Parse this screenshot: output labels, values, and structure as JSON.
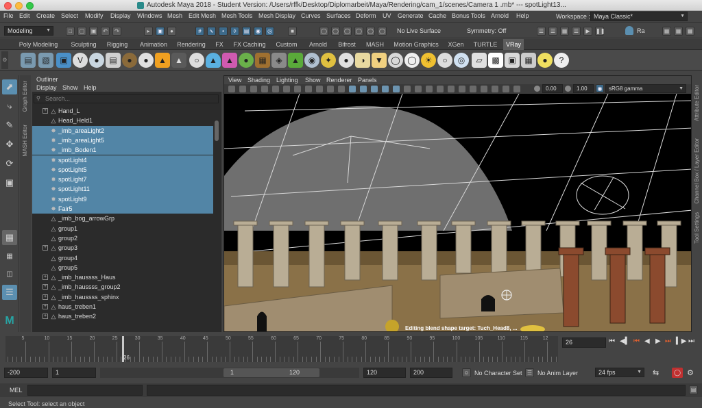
{
  "titlebar": {
    "title": "Autodesk Maya 2018 - Student Version: /Users/rffk/Desktop/Diplomarbeit/Maya/Rendering/cam_1/scenes/Camera 1 .mb*   ---   spotLight13...",
    "tail": "spotLight13..."
  },
  "menubar": {
    "items": [
      "File",
      "Edit",
      "Create",
      "Select",
      "Modify",
      "Display",
      "Windows",
      "Mesh",
      "Edit Mesh",
      "Mesh Tools",
      "Mesh Display",
      "Curves",
      "Surfaces",
      "Deform",
      "UV",
      "Generate",
      "Cache",
      "Bonus Tools",
      "Arnold",
      "Help"
    ],
    "workspace_label": "Workspace :",
    "workspace_value": "Maya Classic*"
  },
  "statusline": {
    "mode": "Modeling",
    "live_surface": "No Live Surface",
    "symmetry": "Symmetry: Off",
    "user": "Ra"
  },
  "shelf": {
    "tabs": [
      "Poly Modeling",
      "Sculpting",
      "Rigging",
      "Animation",
      "Rendering",
      "FX",
      "FX Caching",
      "Custom",
      "Arnold",
      "Bifrost",
      "MASH",
      "Motion Graphics",
      "XGen",
      "TURTLE",
      "VRay"
    ],
    "active_tab": "VRay"
  },
  "side_tabs": {
    "left_top": "Graph Editor",
    "left_bottom": "MASH Editor",
    "right_top": "Attribute Editor",
    "right_mid": "Channel Box / Layer Editor",
    "right_bottom": "Tool Settings"
  },
  "outliner": {
    "title": "Outliner",
    "menu": [
      "Display",
      "Show",
      "Help"
    ],
    "search_placeholder": "Search...",
    "rows": [
      {
        "label": "Hand_L",
        "expand": true,
        "selected": false,
        "icon": "mesh"
      },
      {
        "label": "Head_Held1",
        "expand": false,
        "selected": false,
        "icon": "mesh"
      },
      {
        "label": "_imb_areaLight2",
        "expand": false,
        "selected": true,
        "icon": "light"
      },
      {
        "label": "_imb_areaLight5",
        "expand": false,
        "selected": true,
        "icon": "light"
      },
      {
        "label": "_imb_Boden1",
        "expand": false,
        "selected": true,
        "icon": "light"
      },
      {
        "label": "spotLight4",
        "expand": false,
        "selected": true,
        "icon": "light"
      },
      {
        "label": "spotLight5",
        "expand": false,
        "selected": true,
        "icon": "light"
      },
      {
        "label": "spotLight7",
        "expand": false,
        "selected": true,
        "icon": "light"
      },
      {
        "label": "spotLight11",
        "expand": false,
        "selected": true,
        "icon": "light"
      },
      {
        "label": "spotLight9",
        "expand": false,
        "selected": true,
        "icon": "light"
      },
      {
        "label": "Fair5",
        "expand": false,
        "selected": true,
        "icon": "light"
      },
      {
        "label": "_imb_bog_arrowGrp",
        "expand": false,
        "selected": false,
        "icon": "mesh"
      },
      {
        "label": "group1",
        "expand": false,
        "selected": false,
        "icon": "mesh"
      },
      {
        "label": "group2",
        "expand": false,
        "selected": false,
        "icon": "mesh"
      },
      {
        "label": "group3",
        "expand": true,
        "selected": false,
        "icon": "mesh"
      },
      {
        "label": "group4",
        "expand": false,
        "selected": false,
        "icon": "mesh"
      },
      {
        "label": "group5",
        "expand": false,
        "selected": false,
        "icon": "mesh"
      },
      {
        "label": "_imb_haussss_Haus",
        "expand": true,
        "selected": false,
        "icon": "mesh"
      },
      {
        "label": "_imb_haussss_group2",
        "expand": true,
        "selected": false,
        "icon": "mesh"
      },
      {
        "label": "_imb_haussss_sphinx",
        "expand": true,
        "selected": false,
        "icon": "mesh"
      },
      {
        "label": "haus_treben1",
        "expand": true,
        "selected": false,
        "icon": "mesh"
      },
      {
        "label": "haus_treben2",
        "expand": true,
        "selected": false,
        "icon": "mesh"
      }
    ]
  },
  "viewport": {
    "menu": [
      "View",
      "Shading",
      "Lighting",
      "Show",
      "Renderer",
      "Panels"
    ],
    "exposure": "0.00",
    "gamma": "1.00",
    "color_space": "sRG8 gamma",
    "hud_message": "Editing blend shape target: Tuch_Head8, ..."
  },
  "timeline": {
    "ticks": [
      "5",
      "10",
      "15",
      "20",
      "25",
      "30",
      "35",
      "40",
      "45",
      "50",
      "55",
      "60",
      "65",
      "70",
      "75",
      "80",
      "85",
      "90",
      "95",
      "100",
      "105",
      "110",
      "115",
      "12"
    ],
    "current_frame_marker": "26",
    "current_frame_field": "26"
  },
  "range": {
    "start": "-200",
    "playback_start": "1",
    "slider_start": "1",
    "slider_end": "120",
    "playback_end": "120",
    "end": "200",
    "character_set": "No Character Set",
    "anim_layer": "No Anim Layer",
    "fps": "24 fps"
  },
  "command": {
    "mel_label": "MEL",
    "help_text": "Select Tool: select an object"
  }
}
